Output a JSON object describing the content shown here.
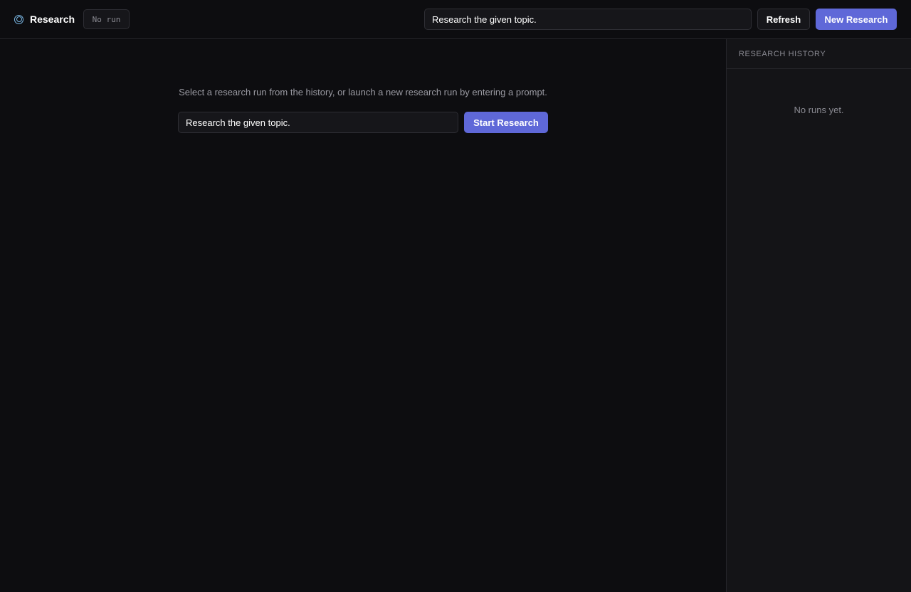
{
  "header": {
    "title": "Research",
    "run_badge": "No run",
    "prompt_value": "Research the given topic.",
    "refresh_label": "Refresh",
    "new_research_label": "New Research"
  },
  "main": {
    "hint": "Select a research run from the history, or launch a new research run by entering a prompt.",
    "prompt_value": "Research the given topic.",
    "start_label": "Start Research"
  },
  "sidebar": {
    "title": "RESEARCH HISTORY",
    "empty_text": "No runs yet."
  },
  "colors": {
    "accent": "#5f68d8",
    "background": "#0d0d10",
    "sidebar_background": "#141417",
    "brand_icon": "#7ab8e6"
  },
  "icons": {
    "brand": "research-circle-icon"
  }
}
